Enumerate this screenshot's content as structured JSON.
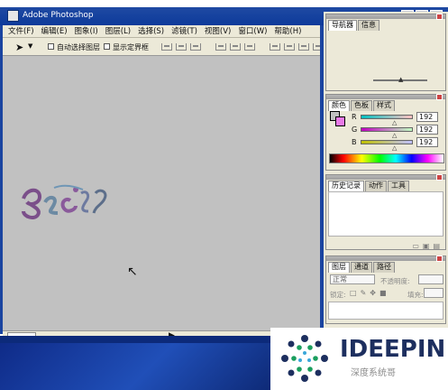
{
  "window": {
    "title": "Adobe Photoshop",
    "buttons": [
      "_",
      "□",
      "×"
    ]
  },
  "menu": [
    "文件(F)",
    "编辑(E)",
    "图象(I)",
    "图层(L)",
    "选择(S)",
    "滤镜(T)",
    "视图(V)",
    "窗口(W)",
    "帮助(H)"
  ],
  "toolbar": {
    "auto_select": "自动选择图层",
    "show_bounds": "显示定界框"
  },
  "panels": {
    "navigator": {
      "tabs": [
        "导航器",
        "信息"
      ]
    },
    "color": {
      "tabs": [
        "颜色",
        "色板",
        "样式"
      ],
      "channels": [
        {
          "label": "R",
          "value": "192"
        },
        {
          "label": "G",
          "value": "192"
        },
        {
          "label": "B",
          "value": "192"
        }
      ],
      "colors": {
        "foreground": "#c0c0c0",
        "background": "#ea7ae8"
      }
    },
    "history": {
      "tabs": [
        "历史记录",
        "动作",
        "工具"
      ]
    },
    "layers": {
      "tabs": [
        "图层",
        "通道",
        "路径"
      ],
      "mode": "正常",
      "opacity_label": "不透明度:",
      "lock_label": "锁定:",
      "fill_label": "填充:"
    }
  },
  "watermark": {
    "brand": "IDEEPIN",
    "caption": "深度系统哥"
  }
}
